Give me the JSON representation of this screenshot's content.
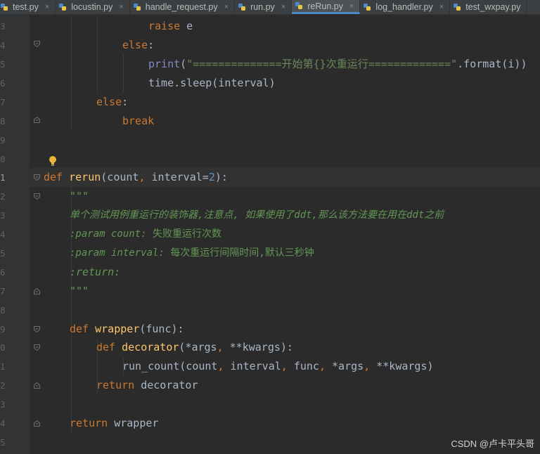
{
  "tabs": [
    {
      "label": "test.py",
      "active": false
    },
    {
      "label": "locustin.py",
      "active": false
    },
    {
      "label": "handle_request.py",
      "active": false
    },
    {
      "label": "run.py",
      "active": false
    },
    {
      "label": "reRun.py",
      "active": true
    },
    {
      "label": "log_handler.py",
      "active": false
    },
    {
      "label": "test_wxpay.py",
      "active": false
    }
  ],
  "tab_close_glyph": "×",
  "line_numbers": [
    "3",
    "4",
    "5",
    "6",
    "7",
    "8",
    "9",
    "0",
    "1",
    "2",
    "3",
    "4",
    "5",
    "6",
    "7",
    "8",
    "9",
    "0",
    "1",
    "2",
    "3",
    "4",
    "5"
  ],
  "current_line_number": "1",
  "code": {
    "l03": {
      "a": "raise",
      "b": " e"
    },
    "l04": {
      "a": "else",
      "b": ":"
    },
    "l05": {
      "a": "print",
      "b": "(",
      "c": "\"==============开始第{}次重运行=============\"",
      "d": ".format(i))"
    },
    "l06": {
      "a": "time.sleep(interval)"
    },
    "l07": {
      "a": "else",
      "b": ":"
    },
    "l08": {
      "a": "break"
    },
    "l11": {
      "a": "def",
      "b": " ",
      "c": "rerun",
      "d": "(count",
      "e": ",",
      "f": " interval=",
      "g": "2",
      "h": "):"
    },
    "l12": {
      "a": "\"\"\""
    },
    "l13": {
      "a": "单个测试用例重运行的装饰器,注意点, 如果使用了ddt,那么该方法要在用在ddt之前"
    },
    "l14": {
      "a": ":param count:",
      "b": " 失败重运行次数"
    },
    "l15": {
      "a": ":param interval:",
      "b": " 每次重运行间隔时间,默认三秒钟"
    },
    "l16": {
      "a": ":return:"
    },
    "l17": {
      "a": "\"\"\""
    },
    "l19": {
      "a": "def",
      "b": " ",
      "c": "wrapper",
      "d": "(func):"
    },
    "l20": {
      "a": "def",
      "b": " ",
      "c": "decorator",
      "d": "(*args",
      "e": ",",
      "f": " **kwargs):"
    },
    "l21": {
      "a": "run_count(count",
      "b": ",",
      "c": " interval",
      "d": ",",
      "e": " func",
      "f": ",",
      "g": " *args",
      "h": ",",
      "i": " **kwargs)"
    },
    "l22": {
      "a": "return",
      "b": " decorator"
    },
    "l24": {
      "a": "return",
      "b": " wrapper"
    }
  },
  "watermark": "CSDN @卢卡平头哥",
  "colors": {
    "background": "#2b2b2b",
    "keyword": "#cc7832",
    "function": "#ffc66d",
    "number": "#6897bb",
    "string": "#6a8759",
    "docstring": "#629755",
    "builtin": "#8888c6",
    "text": "#a9b7c6",
    "active_tab_underline": "#4a88c7"
  },
  "icons": [
    "python-file-icon",
    "fold-marker-icon",
    "intention-bulb-icon"
  ]
}
